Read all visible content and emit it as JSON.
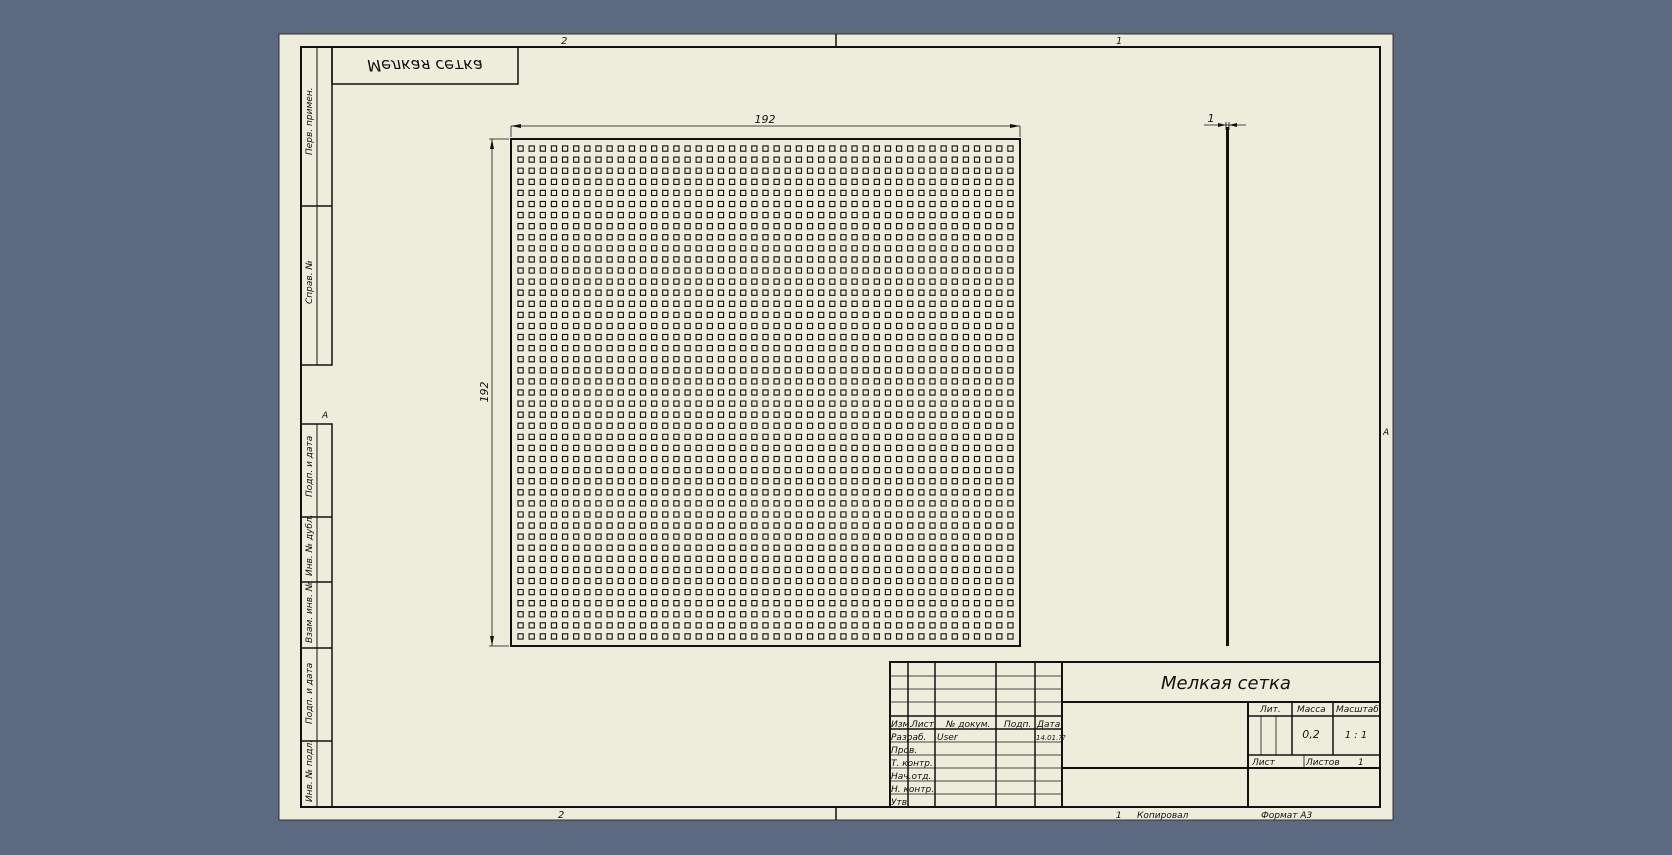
{
  "sheet": {
    "zones_top": [
      "2",
      "1"
    ],
    "zones_bottom": [
      "2",
      "1"
    ],
    "zone_side": "A"
  },
  "stamp_mirrored": "Мелкая сетка",
  "side_stamp": {
    "perv_primen": "Перв. примен.",
    "sprav_no": "Справ. №",
    "podp_data_1": "Подп. и дата",
    "inv_dubl": "Инв. № дубл.",
    "vzam_inv": "Взам. инв. №",
    "podp_data_2": "Подп. и дата",
    "inv_podl": "Инв. № подл."
  },
  "views": {
    "front": {
      "dim_width": "192",
      "dim_height": "192",
      "holes_cols": 45,
      "holes_rows": 45
    },
    "side": {
      "dim_thickness": "1"
    }
  },
  "title_block": {
    "name": "Мелкая сетка",
    "headers": {
      "izm": "Изм.",
      "list": "Лист",
      "doc_no": "№ докум.",
      "podp": "Подп.",
      "data": "Дата"
    },
    "roles": [
      "Разраб.",
      "Пров.",
      "Т. контр.",
      "Нач.отд.",
      "Н. контр.",
      "Утв."
    ],
    "developer": "User",
    "date": "14.01.??",
    "lit_label": "Лит.",
    "massa_label": "Масса",
    "masshtab_label": "Масштаб",
    "massa_value": "0,2",
    "masshtab_value": "1 : 1",
    "list_label": "Лист",
    "listov_label": "Листов",
    "listov_value": "1"
  },
  "footer": {
    "sheet_no": "1",
    "copied": "Копировал",
    "format": "Формат А3"
  },
  "colors": {
    "background": "#5b6a80",
    "paper": "#eeeddc",
    "line": "#111111"
  }
}
